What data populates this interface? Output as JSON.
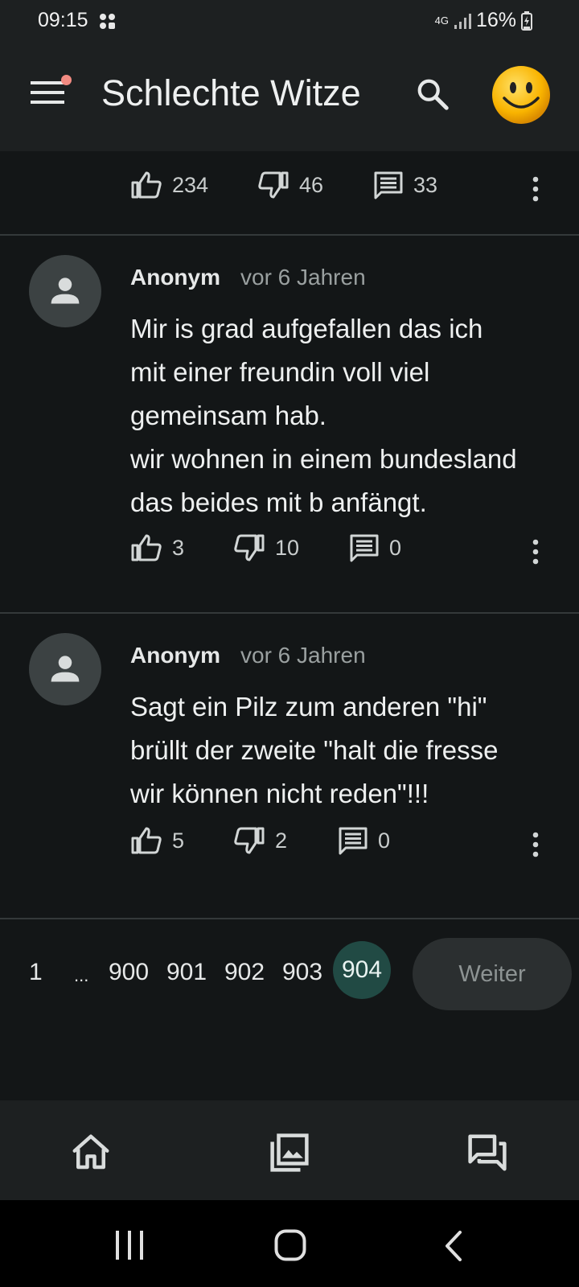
{
  "status_bar": {
    "time": "09:15",
    "network": "4G",
    "battery": "16%"
  },
  "app_bar": {
    "title": "Schlechte Witze"
  },
  "top_actions": {
    "likes": "234",
    "dislikes": "46",
    "comments": "33"
  },
  "comments": [
    {
      "author": "Anonym",
      "time": "vor 6 Jahren",
      "text": "Mir is grad aufgefallen das ich\nmit einer freundin voll viel\ngemeinsam hab.\nwir wohnen in einem bundesland\ndas beides mit b anfängt.",
      "likes": "3",
      "dislikes": "10",
      "comments": "0"
    },
    {
      "author": "Anonym",
      "time": "vor 6 Jahren",
      "text": "Sagt ein Pilz zum anderen \"hi\"\nbrüllt der zweite \"halt die fresse\nwir können nicht reden\"!!!",
      "likes": "5",
      "dislikes": "2",
      "comments": "0"
    }
  ],
  "pagination": {
    "first": "1",
    "ellipsis": "...",
    "pages": [
      "900",
      "901",
      "902",
      "903"
    ],
    "current": "904",
    "next_label": "Weiter"
  },
  "colors": {
    "background": "#131617",
    "surface": "#1d2021",
    "accent": "#214a44",
    "notification_dot": "#f28b82"
  },
  "icons": [
    "menu-icon",
    "search-icon",
    "smiley-icon",
    "thumbs-up-icon",
    "thumbs-down-icon",
    "comment-icon",
    "more-vert-icon",
    "person-icon",
    "home-icon",
    "gallery-icon",
    "forum-icon"
  ]
}
